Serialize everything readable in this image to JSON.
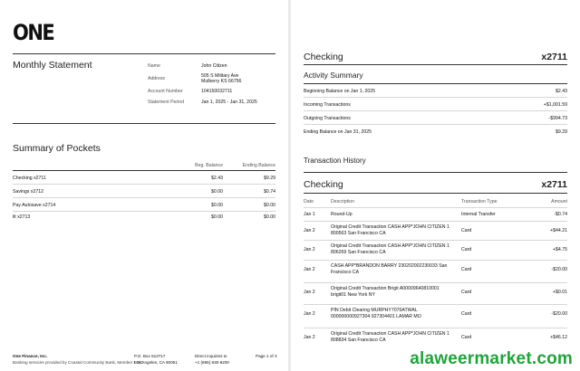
{
  "page1": {
    "logo": "ONE",
    "statement_title": "Monthly Statement",
    "info": [
      {
        "label": "Name",
        "value": "John Citizen"
      },
      {
        "label": "Address",
        "value": "505 S Military Ave\nMulberry KS 66756"
      },
      {
        "label": "Account Number",
        "value": "104150032711"
      },
      {
        "label": "Statement Period",
        "value": "Jan 1, 2025 - Jan 31, 2025"
      }
    ],
    "pockets_title": "Summary of Pockets",
    "pockets_headers": [
      "Beg. Balance",
      "Ending Balance"
    ],
    "pockets": [
      {
        "name": "Checking  x2711",
        "beg": "$2.43",
        "end": "$9.29"
      },
      {
        "name": "Savings  x2712",
        "beg": "$0.00",
        "end": "$0.74"
      },
      {
        "name": "Pay Autosave  x2714",
        "beg": "$0.00",
        "end": "$0.00"
      },
      {
        "name": "lit  x2713",
        "beg": "$0.00",
        "end": "$0.00"
      }
    ],
    "footer": {
      "company": "One Finance, Inc.",
      "disclaimer": "Banking services provided by Coastal Community Bank, Member FDIC",
      "pobox": "P.O. Box 513717",
      "city": "Los Angeles, CA 90051",
      "direct": "Direct inquiries to",
      "phone": "+1 (855) 830-6200",
      "page": "Page 1 of 3"
    }
  },
  "page2": {
    "account_title": "Checking",
    "account_number": "x2711",
    "activity_title": "Activity Summary",
    "activity": [
      {
        "label": "Beginning Balance on Jan 1, 2025",
        "value": "$2.43"
      },
      {
        "label": "Incoming Transactions",
        "value": "+$1,001.59"
      },
      {
        "label": "Outgoing Transactions",
        "value": "-$994.73"
      },
      {
        "label": "Ending Balance on Jan 31, 2025",
        "value": "$9.29"
      }
    ],
    "history_title": "Transaction History",
    "history_account_title": "Checking",
    "history_account_number": "x2711",
    "columns": [
      "Date",
      "Description",
      "Transaction Type",
      "Amount"
    ],
    "transactions": [
      {
        "date": "Jan 1",
        "desc": "Round-Up",
        "type": "Internal Transfer",
        "amount": "-$0.74"
      },
      {
        "date": "Jan 2",
        "desc": "Original Credit Transaction CASH APP*JOHN CITIZEN 1 800563 San Francisco CA",
        "type": "Card",
        "amount": "+$44.21"
      },
      {
        "date": "Jan 2",
        "desc": "Original Credit Transaction CASH APP*JOHN CITIZEN 1 806269 San Francisco CA",
        "type": "Card",
        "amount": "+$4.75"
      },
      {
        "date": "Jan 2",
        "desc": "CASH APP*BRANDON BARRY 230202002230033 San Francisco CA",
        "type": "Card",
        "amount": "-$20.00"
      },
      {
        "date": "Jan 2",
        "desc": "Original Credit Transaction Brigit A00009640810001 brigit01 New York NY",
        "type": "Card",
        "amount": "+$0.01"
      },
      {
        "date": "Jan 2",
        "desc": "PIN Debit Clearing MURPHY7076ATWAL 000000000927304 927304401 LAMAR MO",
        "type": "Card",
        "amount": "-$20.00"
      },
      {
        "date": "Jan 2",
        "desc": "Original Credit Transaction CASH APP*JOHN CITIZEN 1 808834 San Francisco CA",
        "type": "Card",
        "amount": "+$46.12"
      }
    ]
  },
  "watermark": "alaweermarket.com"
}
